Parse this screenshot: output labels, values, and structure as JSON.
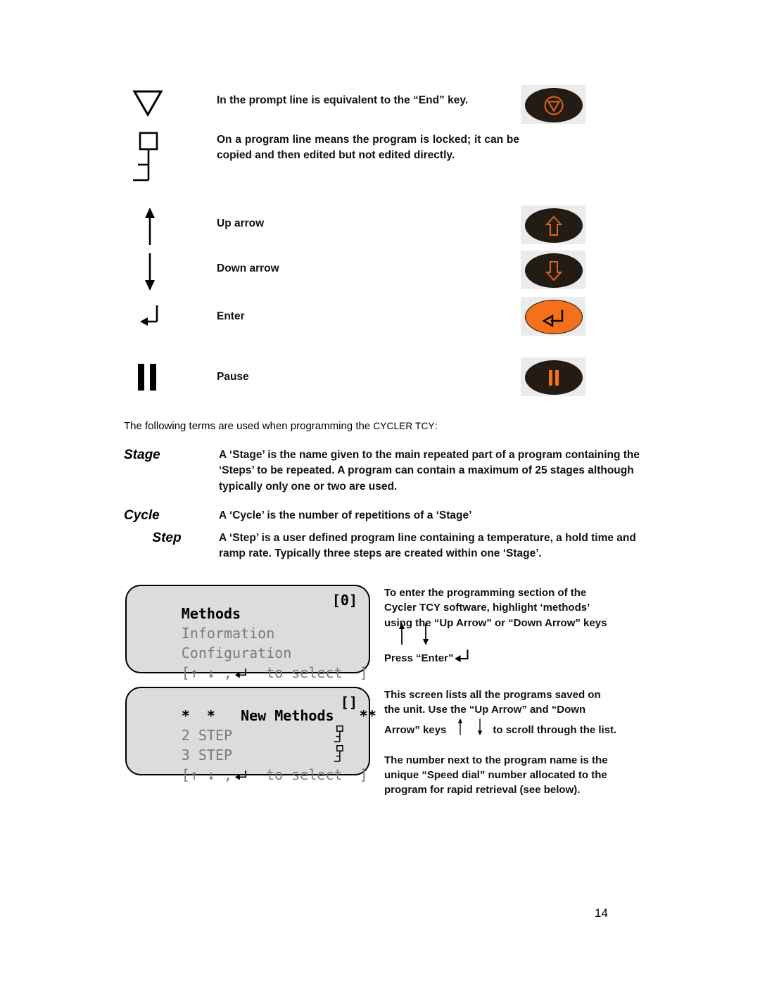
{
  "page": {
    "number": "14",
    "intro_prefix": "The following terms are used when programming the ",
    "intro_device": "CYCLER TCY",
    "intro_suffix": ":"
  },
  "legend": {
    "rows": [
      {
        "symbol": "down-triangle-symbol",
        "description": "In the prompt line is equivalent to the “End” key.",
        "key_icon": "stop-end-key",
        "key_style": "dark",
        "justify": false
      },
      {
        "symbol": "program-locked-symbol",
        "description": "On a program line means the program is locked; it can be copied and then edited but not edited directly.",
        "key_icon": "",
        "key_style": "",
        "justify": true
      },
      {
        "symbol": "up-arrow-symbol",
        "description": "Up arrow",
        "key_icon": "up-arrow-key",
        "key_style": "dark",
        "justify": false
      },
      {
        "symbol": "down-arrow-symbol",
        "description": "Down arrow",
        "key_icon": "down-arrow-key",
        "key_style": "dark",
        "justify": false
      },
      {
        "symbol": "enter-symbol",
        "description": "Enter",
        "key_icon": "enter-key",
        "key_style": "orange",
        "justify": false
      },
      {
        "symbol": "pause-symbol",
        "description": "Pause",
        "key_icon": "pause-key",
        "key_style": "dark",
        "justify": false
      }
    ]
  },
  "glossary": [
    {
      "term": "Stage",
      "definition": "A ‘Stage’ is the name given to the main repeated part of a program containing the ‘Steps’ to be repeated. A program can contain a maximum of 25 stages although typically only one or two are used."
    },
    {
      "term": "Cycle",
      "definition": "A ‘Cycle’ is the number of repetitions of a ‘Stage’"
    },
    {
      "term": "Step",
      "definition": "A ‘Step’ is a user defined program line containing a temperature, a hold time and ramp rate. Typically three steps are created within one ‘Stage’."
    }
  ],
  "lcd_screens": [
    {
      "name": "methods-menu-screen",
      "title": "Methods",
      "title_right": "[0]",
      "items": [
        "Information",
        "Configuration"
      ],
      "prompt_open": "[",
      "prompt_arrows": "↑ ↓ ,",
      "prompt_text": "  to select  ",
      "prompt_close": "]"
    },
    {
      "name": "new-methods-list-screen",
      "title": "*  *   New Methods   **",
      "title_right": "[]",
      "items": [
        "2 STEP",
        "3 STEP"
      ],
      "item_locked": [
        true,
        true
      ],
      "prompt_open": "[",
      "prompt_arrows": "↑ ↓ ,",
      "prompt_text": "  to select  ",
      "prompt_close": "]"
    }
  ],
  "notes": [
    {
      "name": "methods-entry-note",
      "line1": "To enter the programming section of the",
      "line2": "Cycler TCY software, highlight ‘methods’",
      "line3": "using the “Up Arrow” or “Down Arrow” keys",
      "line4": "Press “Enter”"
    },
    {
      "name": "program-list-note",
      "para1_a": "This screen lists all the programs saved on",
      "para1_b": "the unit. Use the “Up Arrow” and “Down",
      "para1_c": "Arrow” keys",
      "para1_d": "to scroll through the list.",
      "para2_a": "The number next to the program name is the",
      "para2_b": "unique “Speed dial” number allocated to the",
      "para2_c": "program for rapid retrieval (see below)."
    }
  ],
  "colors": {
    "key_orange": "#F4701B",
    "key_dark": "#231c14",
    "lcd_background": "#dcdcdc",
    "lcd_dim_text": "#7a7a7a"
  }
}
